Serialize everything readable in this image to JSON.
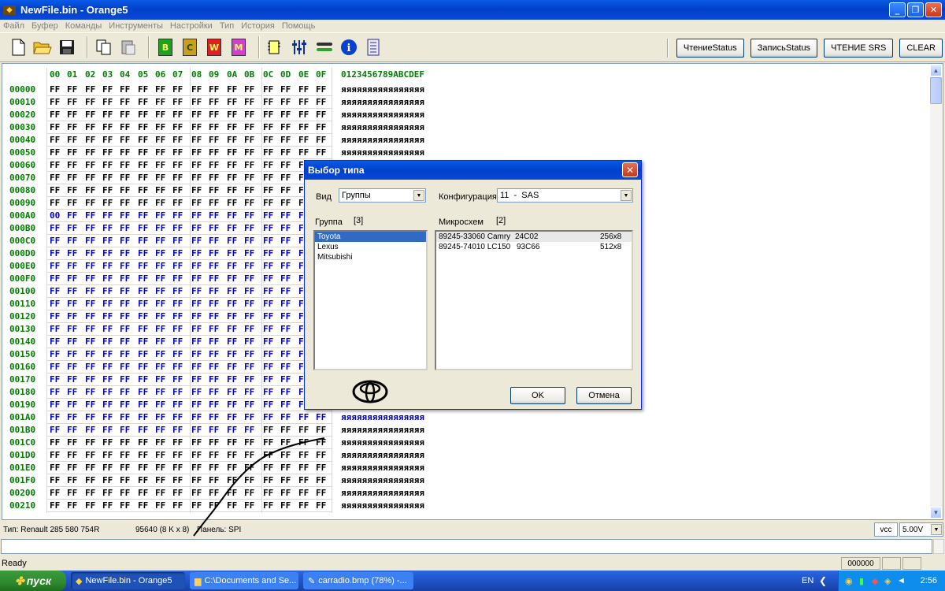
{
  "window": {
    "title": "NewFile.bin - Orange5"
  },
  "menu": [
    "Файл",
    "Буфер",
    "Команды",
    "Инструменты",
    "Настройки",
    "Тип",
    "История",
    "Помощь"
  ],
  "toolbar": {
    "chips": [
      "В",
      "С",
      "W",
      "M"
    ],
    "buttons_right": [
      "ЧтениеStatus",
      "ЗаписьStatus",
      "ЧТЕНИЕ SRS",
      "CLEAR"
    ]
  },
  "hex": {
    "col_headers": [
      "00",
      "01",
      "02",
      "03",
      "04",
      "05",
      "06",
      "07",
      "08",
      "09",
      "0A",
      "0B",
      "0C",
      "0D",
      "0E",
      "0F"
    ],
    "ascii_header": "0123456789ABCDEF",
    "addresses": [
      "00000",
      "00010",
      "00020",
      "00030",
      "00040",
      "00050",
      "00060",
      "00070",
      "00080",
      "00090",
      "000A0",
      "000B0",
      "000C0",
      "000D0",
      "000E0",
      "000F0",
      "00100",
      "00110",
      "00120",
      "00130",
      "00140",
      "00150",
      "00160",
      "00170",
      "00180",
      "00190",
      "001A0",
      "001B0",
      "001C0",
      "001D0",
      "001E0",
      "001F0",
      "00200",
      "00210"
    ],
    "byte_value": "FF",
    "ascii_value": "яяяяяяяяяяяяяяяя",
    "special_byte": {
      "address": "000A0",
      "value": "00"
    },
    "colors": {
      "address": "#008000",
      "selected": "#0000c0",
      "default": "#000000"
    }
  },
  "status": {
    "type": "Тип: Renault 285 580 754R",
    "size": "95640 (8 K x 8)",
    "panel": "Панель: SPI",
    "vcc_label": "vcc",
    "voltage": "5.00V"
  },
  "ready_text": "Ready",
  "status_counter": "000000",
  "taskbar": {
    "start": "пуск",
    "tasks": [
      "NewFile.bin - Orange5",
      "C:\\Documents and Se...",
      "carradio.bmp (78%) -..."
    ],
    "lang": "EN",
    "clock": "2:56"
  },
  "dialog": {
    "title": "Выбор типа",
    "view_label": "Вид",
    "view_value": "Группы",
    "config_label": "Конфигурация",
    "config_value": "11  -  SAS",
    "group_label": "Группа",
    "group_count": "[3]",
    "chips_label": "Микросхем",
    "chips_count": "[2]",
    "groups": [
      "Toyota",
      "Lexus",
      "Mitsubishi"
    ],
    "chips": [
      {
        "name": "89245-33060 Camry",
        "chip": "24C02",
        "size": "256x8"
      },
      {
        "name": "89245-74010 LC150",
        "chip": "93C66",
        "size": "512x8"
      }
    ],
    "ok": "OK",
    "cancel": "Отмена",
    "logo": "toyota-logo"
  }
}
